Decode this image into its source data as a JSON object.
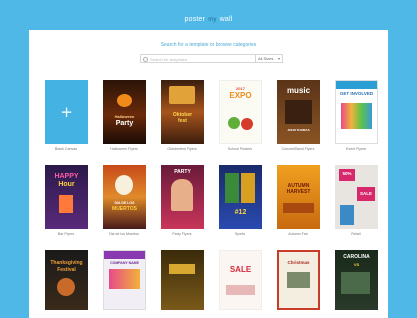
{
  "logo": {
    "left": "poster",
    "mid": "my",
    "right": "wall"
  },
  "header": {
    "prompt": "Search for a template or browse categories"
  },
  "search": {
    "placeholder": "Search for templates",
    "dropdown": "All Sizes"
  },
  "tiles": [
    {
      "caption": "Blank Canvas"
    },
    {
      "caption": "Halloween Flyers",
      "t1": "Halloween",
      "t2": "Party"
    },
    {
      "caption": "Oktoberfest Flyers",
      "t1": "Oktober",
      "t2": "fest"
    },
    {
      "caption": "School Posters",
      "t1": "2017",
      "t2": "EXPO"
    },
    {
      "caption": "Concert/Band Flyers",
      "t1": "music",
      "t2": "JOHN THOMAS"
    },
    {
      "caption": "Event Flyers",
      "t1": "GET INVOLVED"
    },
    {
      "caption": "Bar Flyers",
      "t1": "HAPPY",
      "t2": "Hour"
    },
    {
      "caption": "Dia de los Muertos",
      "t1": "DIA DE LOS",
      "t2": "MUERTOS"
    },
    {
      "caption": "Party Flyers",
      "t1": "PARTY",
      "t2": ""
    },
    {
      "caption": "Sports",
      "t1": "#12"
    },
    {
      "caption": "Autumn Fair",
      "t1": "AUTUMN",
      "t2": "HARVEST"
    },
    {
      "caption": "Retail",
      "t1": "50%",
      "t2": "SALE"
    },
    {
      "caption": "",
      "t1": "Thanksgiving",
      "t2": "Festival"
    },
    {
      "caption": "",
      "t1": "COMPANY NAME"
    },
    {
      "caption": "",
      "t1": ""
    },
    {
      "caption": "",
      "t1": "SALE"
    },
    {
      "caption": "",
      "t1": "Christmas"
    },
    {
      "caption": "",
      "t1": "CAROLINA",
      "t2": "VS"
    }
  ]
}
